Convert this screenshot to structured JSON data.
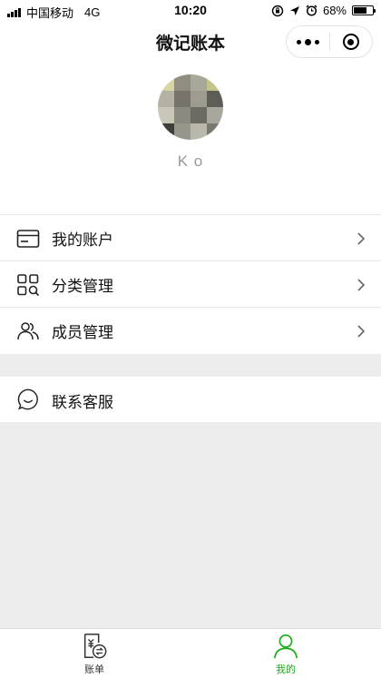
{
  "status_bar": {
    "carrier": "中国移动",
    "network": "4G",
    "time": "10:20",
    "battery": "68%",
    "battery_level": 0.68
  },
  "nav": {
    "title": "微记账本"
  },
  "profile": {
    "username": "K      o"
  },
  "menu": {
    "items": [
      {
        "label": "我的账户",
        "icon": "card-icon"
      },
      {
        "label": "分类管理",
        "icon": "category-grid-icon"
      },
      {
        "label": "成员管理",
        "icon": "members-icon"
      }
    ],
    "service_label": "联系客服"
  },
  "tabbar": {
    "tabs": [
      {
        "label": "账单",
        "icon": "bill-icon"
      },
      {
        "label": "我的",
        "icon": "person-icon"
      }
    ],
    "active_color": "#1aad19",
    "inactive_color": "#333333"
  }
}
